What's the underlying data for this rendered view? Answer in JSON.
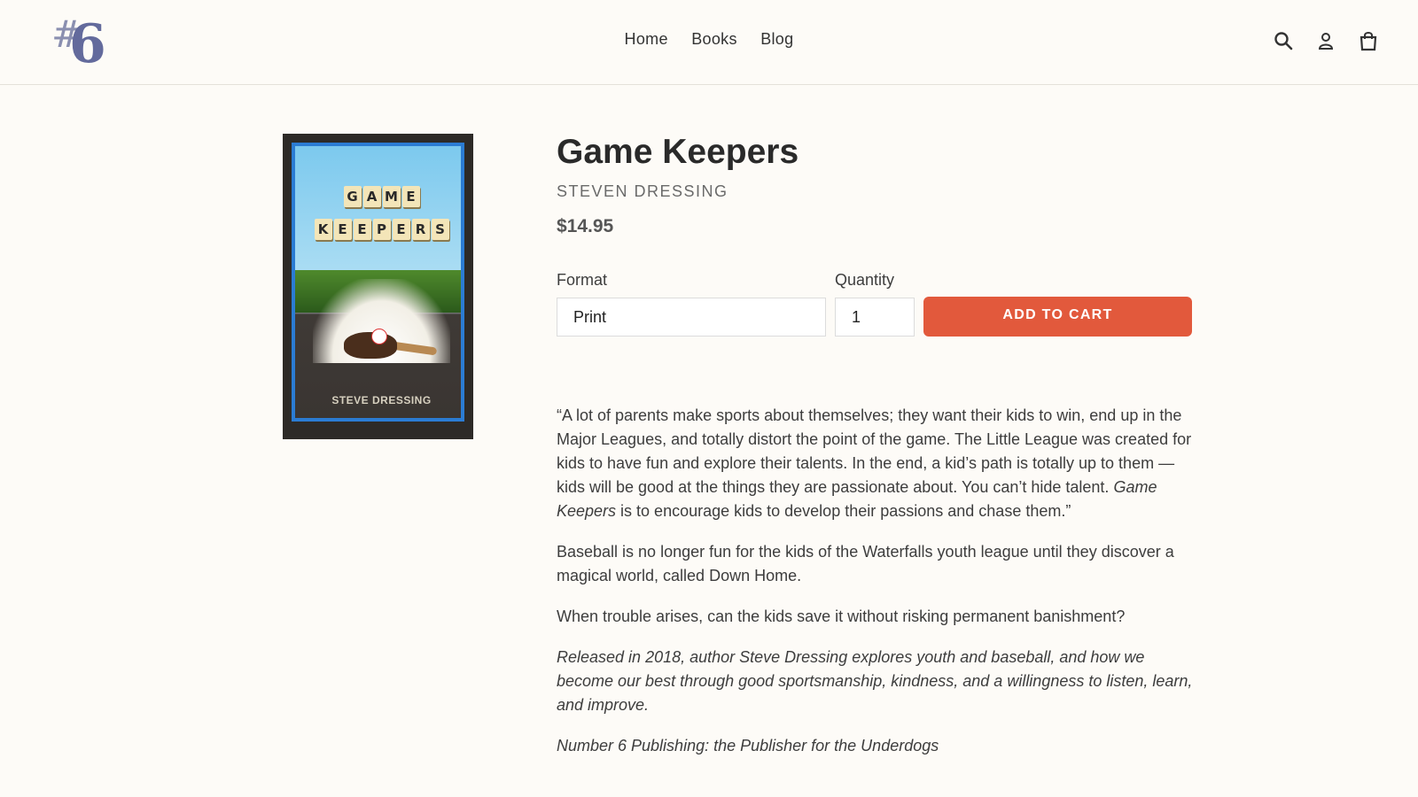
{
  "logo": {
    "hash": "#",
    "digit": "6"
  },
  "nav": [
    {
      "label": "Home"
    },
    {
      "label": "Books"
    },
    {
      "label": "Blog"
    }
  ],
  "header_icons": [
    "search-icon",
    "user-icon",
    "cart-icon"
  ],
  "cover": {
    "line1": [
      "G",
      "A",
      "M",
      "E"
    ],
    "line2": [
      "K",
      "E",
      "E",
      "P",
      "E",
      "R",
      "S"
    ],
    "author": "STEVE DRESSING"
  },
  "product": {
    "title": "Game Keepers",
    "author": "STEVEN DRESSING",
    "price": "$14.95",
    "format_label": "Format",
    "format_value": "Print",
    "quantity_label": "Quantity",
    "quantity_value": "1",
    "add_to_cart": "ADD TO CART"
  },
  "description": {
    "quote_start": "“A lot of parents make sports about themselves; they want their kids to win, end up in the Major Leagues, and totally distort the point of the game. The Little League was created for kids to have fun and explore their talents. In the end, a kid’s path is totally up to them — kids will be good at the things they are passionate about. You can’t hide talent. ",
    "quote_title": "Game Keepers",
    "quote_end": " is to encourage kids to develop their passions and chase them.”",
    "p2": "Baseball is no longer fun for the kids of the Waterfalls youth league until they discover a magical world, called Down Home.",
    "p3": "When trouble arises, can the kids save it without risking permanent banishment?",
    "p4": "Released in 2018, author Steve Dressing explores youth and baseball, and how we become our best through good sportsmanship, kindness, and a willingness to listen, learn, and improve.",
    "p5": "Number 6 Publishing: the Publisher for the Underdogs"
  },
  "colors": {
    "accent": "#e2593c",
    "logo": "#636a9c",
    "background": "#fdfbf7"
  }
}
